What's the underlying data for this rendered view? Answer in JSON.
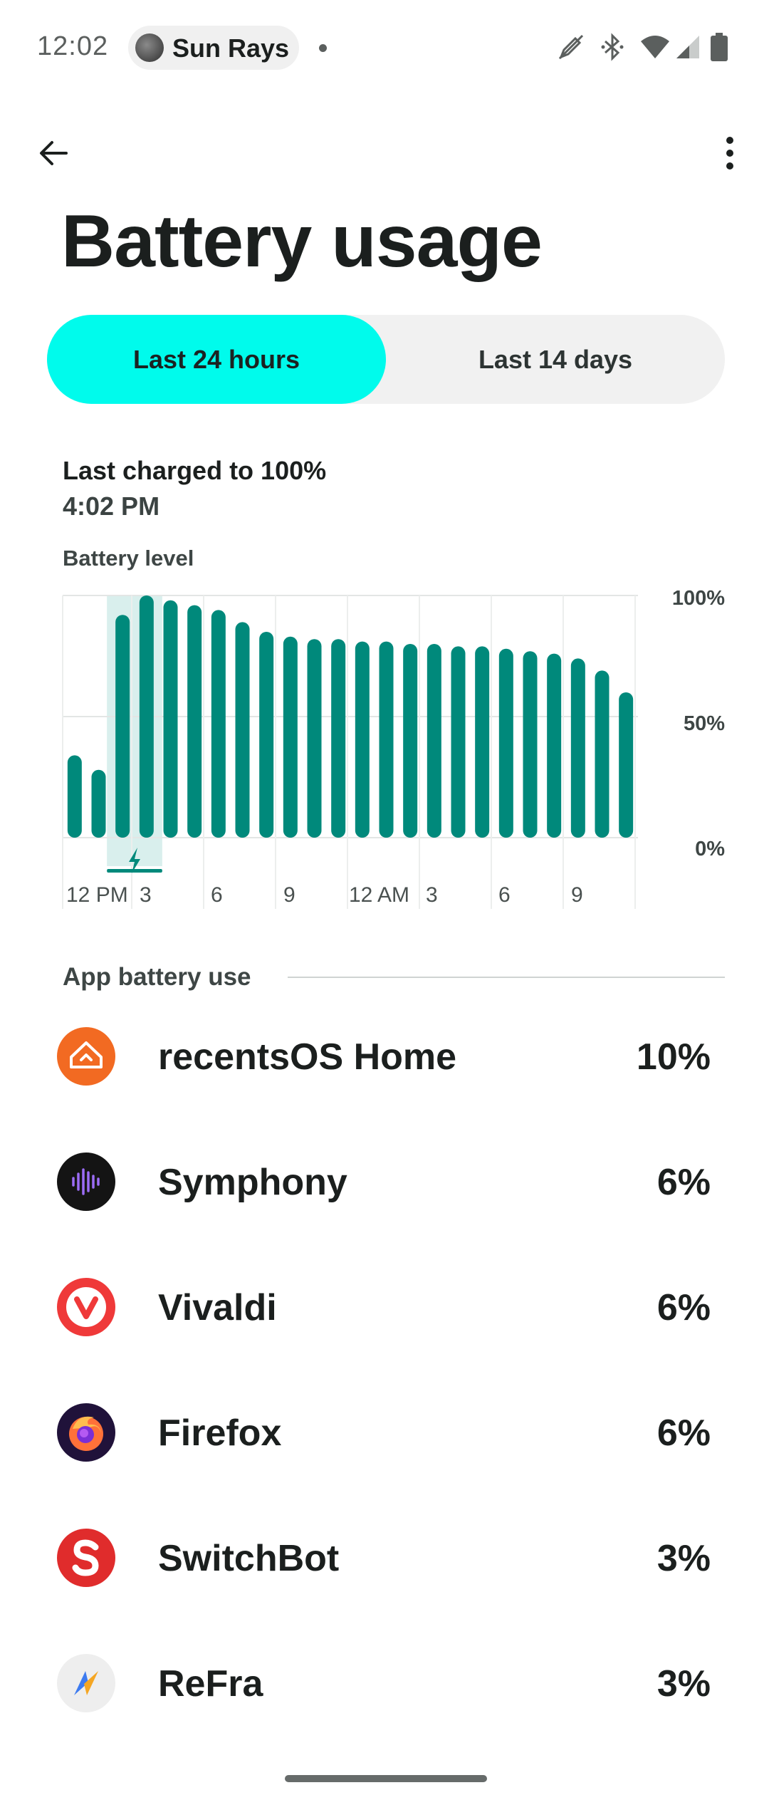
{
  "status_bar": {
    "time": "12:02",
    "media_title": "Sun Rays",
    "icons": [
      "edit-off-icon",
      "bluetooth-icon",
      "wifi-icon",
      "signal-icon",
      "battery-icon"
    ]
  },
  "app_bar": {
    "back_icon": "arrow-back-icon",
    "more_icon": "more-vert-icon"
  },
  "title": "Battery usage",
  "tabs": [
    {
      "label": "Last 24 hours",
      "selected": true
    },
    {
      "label": "Last 14 days",
      "selected": false
    }
  ],
  "charge_info": {
    "label": "Last charged to 100%",
    "time": "4:02 PM"
  },
  "chart_data": {
    "type": "bar",
    "title": "Battery level",
    "y_ticks": [
      "100%",
      "50%",
      "0%"
    ],
    "x_ticks": [
      "12 PM",
      "3",
      "6",
      "9",
      "12 AM",
      "3",
      "6",
      "9"
    ],
    "ylim": [
      0,
      100
    ],
    "grid": true,
    "values": [
      34,
      28,
      92,
      100,
      98,
      96,
      94,
      89,
      85,
      83,
      82,
      82,
      81,
      81,
      80,
      80,
      79,
      79,
      78,
      77,
      76,
      74,
      69,
      60
    ],
    "charging_window": [
      2,
      3
    ],
    "accent": "#00897b"
  },
  "app_section": {
    "header": "App battery use",
    "apps": [
      {
        "name": "recentsOS Home",
        "percent": "10%",
        "icon": "recentsos-home-icon"
      },
      {
        "name": "Symphony",
        "percent": "6%",
        "icon": "symphony-icon"
      },
      {
        "name": "Vivaldi",
        "percent": "6%",
        "icon": "vivaldi-icon"
      },
      {
        "name": "Firefox",
        "percent": "6%",
        "icon": "firefox-icon"
      },
      {
        "name": "SwitchBot",
        "percent": "3%",
        "icon": "switchbot-icon"
      },
      {
        "name": "ReFra",
        "percent": "3%",
        "icon": "refra-icon"
      }
    ]
  },
  "colors": {
    "accent_tab": "#00fbec",
    "chart_bar": "#00897b"
  }
}
